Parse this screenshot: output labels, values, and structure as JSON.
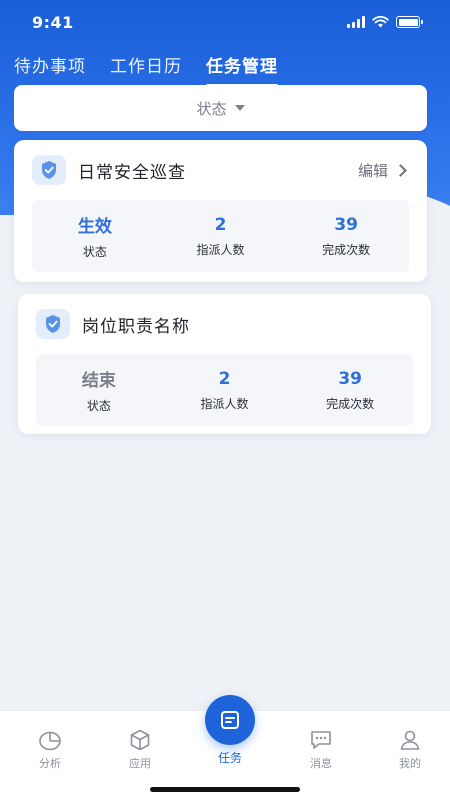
{
  "status_bar": {
    "time": "9:41"
  },
  "tabs": [
    {
      "label": "待办事项",
      "active": false
    },
    {
      "label": "工作日历",
      "active": false
    },
    {
      "label": "任务管理",
      "active": true
    }
  ],
  "filter": {
    "label": "状态"
  },
  "cards": [
    {
      "title": "日常安全巡查",
      "edit_label": "编辑",
      "stats": [
        {
          "value": "生效",
          "label": "状态",
          "color": "#2e6fd8"
        },
        {
          "value": "2",
          "label": "指派人数",
          "color": "#2e6fd8"
        },
        {
          "value": "39",
          "label": "完成次数",
          "color": "#2e6fd8"
        }
      ]
    },
    {
      "title": "岗位职责名称",
      "stats": [
        {
          "value": "结束",
          "label": "状态",
          "color": "#7a7f89"
        },
        {
          "value": "2",
          "label": "指派人数",
          "color": "#2e6fd8"
        },
        {
          "value": "39",
          "label": "完成次数",
          "color": "#2e6fd8"
        }
      ]
    }
  ],
  "bottom_nav": [
    {
      "label": "分析",
      "icon": "pie-chart-icon",
      "active": false
    },
    {
      "label": "应用",
      "icon": "cube-icon",
      "active": false
    },
    {
      "label": "任务",
      "icon": "task-icon",
      "active": true
    },
    {
      "label": "消息",
      "icon": "message-icon",
      "active": false
    },
    {
      "label": "我的",
      "icon": "user-icon",
      "active": false
    }
  ],
  "colors": {
    "primary": "#1f63da",
    "stat_blue": "#2e6fd8",
    "muted": "#7a7f89"
  }
}
